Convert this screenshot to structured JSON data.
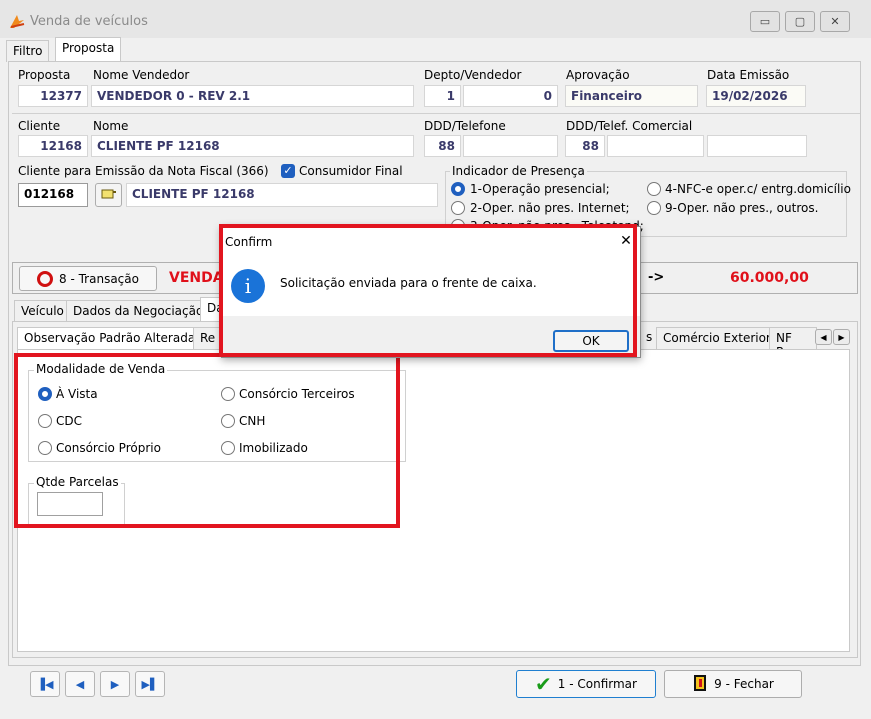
{
  "window": {
    "title": "Venda de veículos",
    "controls": {
      "minimize": "▭",
      "maximize": "▢",
      "close": "✕"
    }
  },
  "top_tabs": [
    "Filtro",
    "Proposta"
  ],
  "header": {
    "proposta_label": "Proposta",
    "proposta_value": "12377",
    "vendedor_label": "Nome Vendedor",
    "vendedor_value": "VENDEDOR 0 - REV 2.1",
    "depto_label": "Depto/Vendedor",
    "depto_value": "1",
    "vendedor_code": "0",
    "aprovacao_label": "Aprovação",
    "aprovacao_value": "Financeiro",
    "data_emissao_label": "Data Emissão",
    "data_emissao_value": "19/02/2026"
  },
  "cliente": {
    "cliente_label": "Cliente",
    "cliente_value": "12168",
    "nome_label": "Nome",
    "nome_value": "CLIENTE PF 12168",
    "ddd_tel_label": "DDD/Telefone",
    "ddd_value": "88",
    "ddd_com_label": "DDD/Telef. Comercial",
    "ddd_com_value": "88",
    "nf_label": "Cliente para Emissão da Nota Fiscal (366)",
    "nf_code": "012168",
    "nf_name": "CLIENTE PF 12168",
    "consumidor_final_label": "Consumidor Final"
  },
  "presenca": {
    "title": "Indicador de Presença",
    "options": [
      "1-Operação presencial;",
      "4-NFC-e oper.c/ entrg.domicílio",
      "2-Oper. não pres. Internet;",
      "9-Oper. não pres., outros.",
      "3-Oper. não pres., Teleatend;"
    ]
  },
  "transacao": {
    "button_label": "8 - Transação",
    "status_text": "VENDA",
    "arrow": "->",
    "total": "60.000,00"
  },
  "sub_tabs": [
    "Veículo",
    "Dados da Negociação",
    "Da"
  ],
  "detail_tabs": [
    "Observação Padrão Alterada",
    "Re",
    "s",
    "Comércio Exterior",
    "NF Re"
  ],
  "modalidade": {
    "title": "Modalidade de Venda",
    "options": [
      "À Vista",
      "Consórcio Terceiros",
      "CDC",
      "CNH",
      "Consórcio Próprio",
      "Imobilizado"
    ],
    "selected": "À Vista"
  },
  "parcelas": {
    "label": "Qtde Parcelas",
    "value": ""
  },
  "footer": {
    "confirm_label": "1 - Confirmar",
    "close_label": "9 - Fechar"
  },
  "dialog": {
    "title": "Confirm",
    "message": "Solicitação enviada para o frente de caixa.",
    "ok_label": "OK",
    "close_glyph": "✕",
    "info_glyph": "i"
  },
  "colors": {
    "accent": "#1f5fbf",
    "highlight": "#e2151f",
    "value_text": "#3a3a6a"
  }
}
